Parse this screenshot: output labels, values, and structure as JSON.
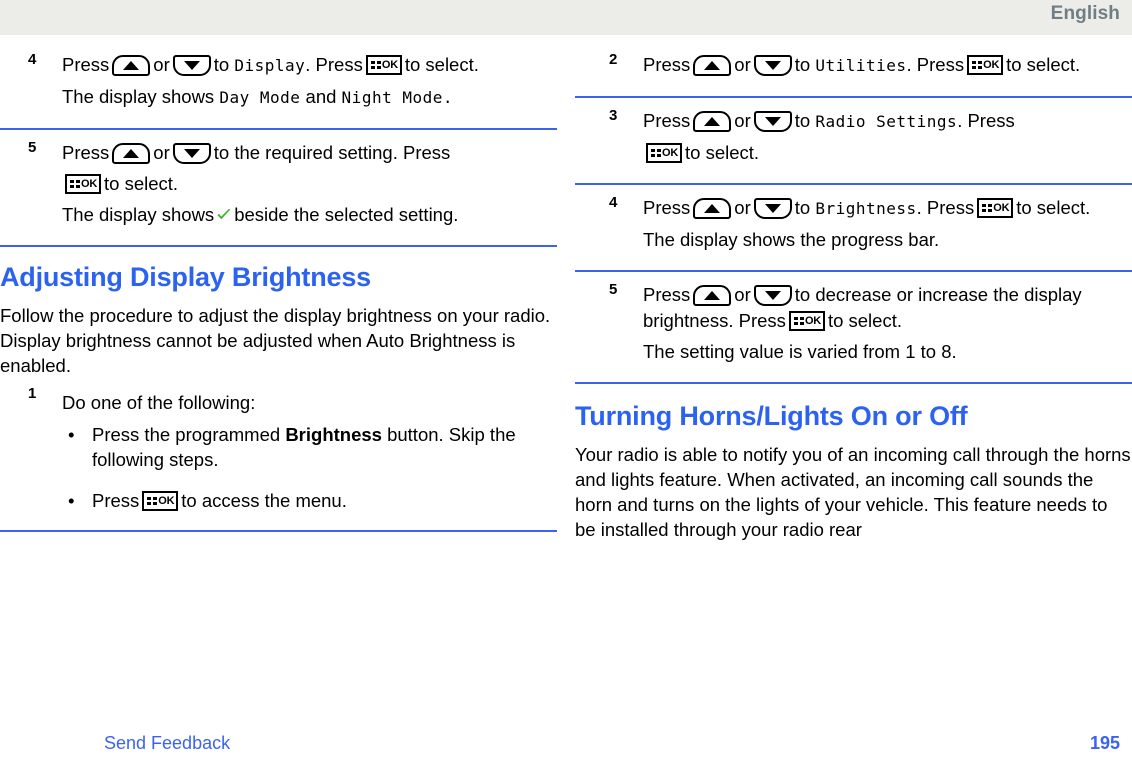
{
  "header": {
    "language": "English"
  },
  "footer": {
    "feedback_label": "Send Feedback",
    "page_number": "195"
  },
  "left_column": {
    "steps": [
      {
        "number": "4",
        "line1_a": "Press",
        "line1_b": "or",
        "line1_c": "to",
        "line1_lcd": "Display",
        "line1_d": ". Press",
        "line1_e": "to select.",
        "result_a": "The display shows",
        "result_lcd1": "Day Mode",
        "result_b": "and",
        "result_lcd2": "Night Mode",
        "result_c": "."
      },
      {
        "number": "5",
        "line1_a": "Press",
        "line1_b": "or",
        "line1_c": "to the required setting. Press",
        "line1_d": "to select.",
        "result_a": "The display shows",
        "result_b": "beside the selected setting."
      }
    ],
    "section": {
      "title": "Adjusting Display Brightness",
      "intro": "Follow the procedure to adjust the display brightness on your radio. Display brightness cannot be adjusted when Auto Brightness is enabled.",
      "step1_number": "1",
      "step1_text": "Do one of the following:",
      "bullets": [
        {
          "text_a": "Press the programmed",
          "bold": "Brightness",
          "text_b": "button. Skip the following steps."
        },
        {
          "text_a": "Press",
          "text_b": "to access the menu."
        }
      ]
    }
  },
  "right_column": {
    "steps": [
      {
        "number": "2",
        "line1_a": "Press",
        "line1_b": "or",
        "line1_c": "to",
        "line1_lcd": "Utilities",
        "line1_d": ". Press",
        "line1_e": "to select."
      },
      {
        "number": "3",
        "line1_a": "Press",
        "line1_b": "or",
        "line1_c": "to",
        "line1_lcd": "Radio Settings",
        "line1_d": ". Press",
        "line1_e": "to select."
      },
      {
        "number": "4",
        "line1_a": "Press",
        "line1_b": "or",
        "line1_c": "to",
        "line1_lcd": "Brightness",
        "line1_d": ". Press",
        "line1_e": "to select.",
        "result": "The display shows the progress bar."
      },
      {
        "number": "5",
        "line1_a": "Press",
        "line1_b": "or",
        "line1_c": "to decrease or increase the display brightness. Press",
        "line1_d": "to select.",
        "result": "The setting value is varied from 1 to 8."
      }
    ],
    "section": {
      "title": "Turning Horns/Lights On or Off",
      "intro": "Your radio is able to notify you of an incoming call through the horns and lights feature. When activated, an incoming call sounds the horn and turns on the lights of your vehicle. This feature needs to be installed through your radio rear"
    }
  },
  "icons": {
    "up_key": "arrow-up-key-icon",
    "down_key": "arrow-down-key-icon",
    "ok_key": "menu-ok-key-icon",
    "check": "green-check-icon"
  },
  "colors": {
    "accent_blue": "#3b63f0",
    "heading_blue": "#2b62f0",
    "header_band": "#ecece9",
    "header_text": "#6f7e85",
    "check_green": "#3cb529"
  }
}
